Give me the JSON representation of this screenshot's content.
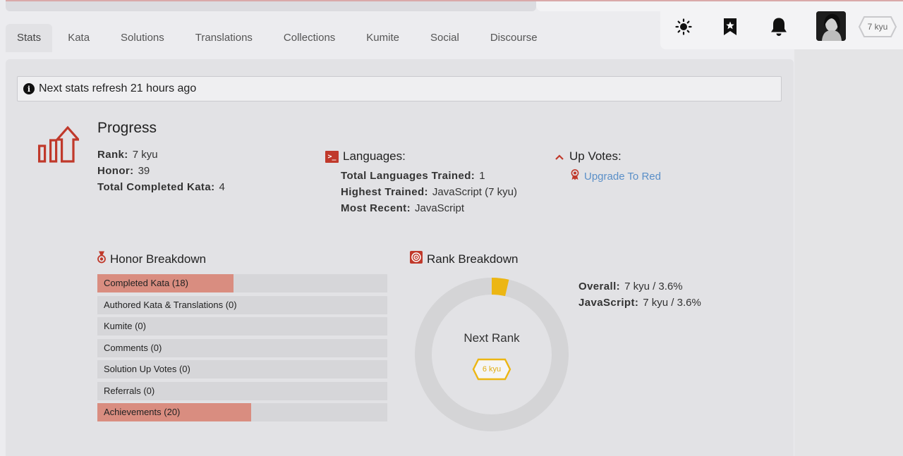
{
  "colors": {
    "accent_red": "#c0392b",
    "bar_fill": "#d98d80",
    "rank_yellow": "#ecb613",
    "link_blue": "#5a8fc8"
  },
  "header": {
    "user_rank": "7 kyu",
    "icons": [
      "sun-icon",
      "bookmark-icon",
      "bell-icon"
    ]
  },
  "tabs": [
    {
      "label": "Stats",
      "active": true
    },
    {
      "label": "Kata"
    },
    {
      "label": "Solutions"
    },
    {
      "label": "Translations"
    },
    {
      "label": "Collections"
    },
    {
      "label": "Kumite"
    },
    {
      "label": "Social"
    },
    {
      "label": "Discourse"
    }
  ],
  "notice": "Next stats refresh 21 hours ago",
  "progress": {
    "title": "Progress",
    "rank_label": "Rank:",
    "rank_value": "7 kyu",
    "honor_label": "Honor:",
    "honor_value": "39",
    "completed_label": "Total Completed Kata:",
    "completed_value": "4"
  },
  "languages": {
    "title": "Languages:",
    "trained_label": "Total Languages Trained:",
    "trained_value": "1",
    "highest_label": "Highest Trained:",
    "highest_value": "JavaScript (7 kyu)",
    "recent_label": "Most Recent:",
    "recent_value": "JavaScript"
  },
  "upvotes": {
    "title": "Up Votes:",
    "link": "Upgrade To Red"
  },
  "honor_breakdown": {
    "title": "Honor Breakdown",
    "bars": [
      {
        "label": "Completed Kata (18)",
        "fraction": 0.47
      },
      {
        "label": "Authored Kata & Translations (0)",
        "fraction": 0
      },
      {
        "label": "Kumite (0)",
        "fraction": 0
      },
      {
        "label": "Comments (0)",
        "fraction": 0
      },
      {
        "label": "Solution Up Votes (0)",
        "fraction": 0
      },
      {
        "label": "Referrals (0)",
        "fraction": 0
      },
      {
        "label": "Achievements (20)",
        "fraction": 0.53
      }
    ]
  },
  "rank_breakdown": {
    "title": "Rank Breakdown",
    "progress_percent": 3.6,
    "next_rank_label": "Next Rank",
    "next_rank": "6 kyu",
    "overall_label": "Overall:",
    "overall_value": "7 kyu / 3.6%",
    "js_label": "JavaScript:",
    "js_value": "7 kyu / 3.6%"
  }
}
